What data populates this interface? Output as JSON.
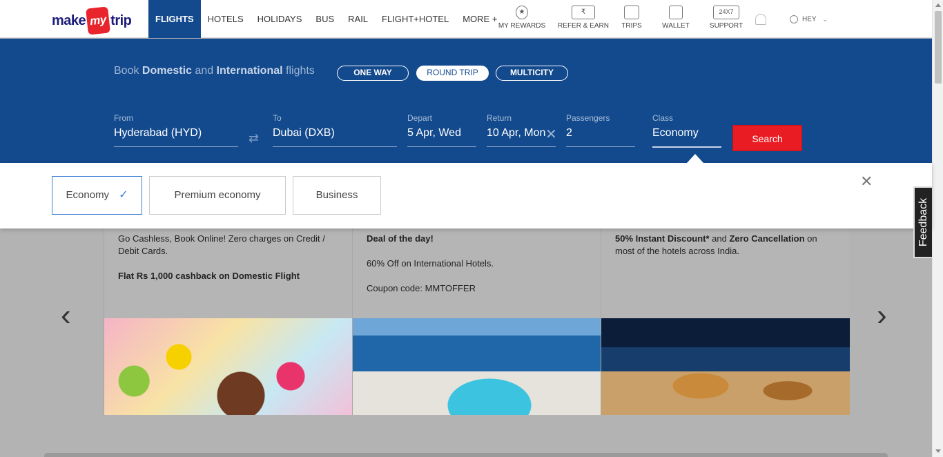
{
  "logo": {
    "pre": "make",
    "my": "my",
    "post": "trip"
  },
  "nav": [
    "FLIGHTS",
    "HOTELS",
    "HOLIDAYS",
    "BUS",
    "RAIL",
    "FLIGHT+HOTEL",
    "MORE +"
  ],
  "header_links": [
    {
      "label": "MY REWARDS",
      "icon": "star-badge-icon"
    },
    {
      "label": "REFER & EARN",
      "icon": "rupee-ticket-icon",
      "glyph": "₹"
    },
    {
      "label": "TRIPS",
      "icon": "briefcase-icon"
    },
    {
      "label": "WALLET",
      "icon": "wallet-icon"
    },
    {
      "label": "SUPPORT",
      "icon": "support-24x7-icon",
      "glyph": "24X7"
    }
  ],
  "user": {
    "label": "HEY"
  },
  "search": {
    "tagline_pre": "Book ",
    "tagline_b1": "Domestic",
    "tagline_mid": " and ",
    "tagline_b2": "International",
    "tagline_post": " flights",
    "trip_types": [
      "ONE WAY",
      "ROUND TRIP",
      "MULTICITY"
    ],
    "selected_trip": "ROUND TRIP",
    "from_label": "From",
    "from_value": "Hyderabad (HYD)",
    "to_label": "To",
    "to_value": "Dubai (DXB)",
    "depart_label": "Depart",
    "depart_value": "5 Apr, Wed",
    "return_label": "Return",
    "return_value": "10 Apr, Mon",
    "pax_label": "Passengers",
    "pax_value": "2",
    "class_label": "Class",
    "class_value": "Economy",
    "search_label": "Search"
  },
  "class_options": {
    "economy": "Economy",
    "premium": "Premium economy",
    "business": "Business",
    "selected": "Economy"
  },
  "offers": {
    "card1_p1": "Go Cashless, Book Online! Zero charges on Credit / Debit Cards.",
    "card1_p2": "Flat Rs 1,000 cashback on Domestic Flight",
    "card2_p1": "Deal of the day!",
    "card2_p2": "60% Off on International Hotels.",
    "card2_p3": "Coupon code: MMTOFFER",
    "card3_b1": "50% Instant Discount*",
    "card3_t1": " and ",
    "card3_b2": "Zero Cancellation",
    "card3_t2": " on most of the hotels across India."
  },
  "feedback": "Feedback",
  "colors": {
    "brand_blue": "#134a8d",
    "search_red": "#ea1c23",
    "check_blue": "#3a7bd5"
  }
}
